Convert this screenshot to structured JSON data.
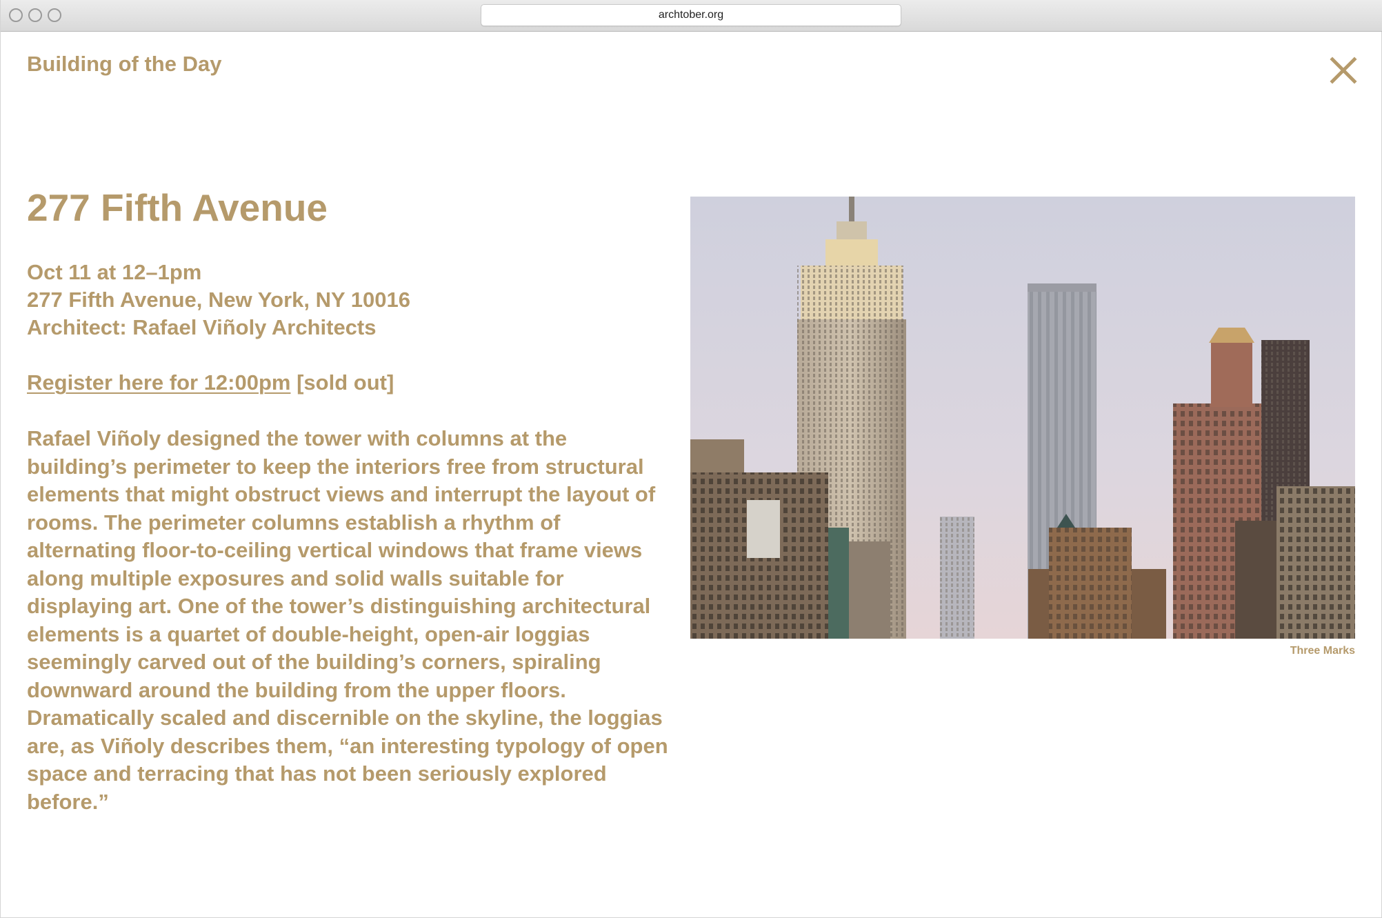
{
  "browser": {
    "url": "archtober.org"
  },
  "header": {
    "section_title": "Building of the Day",
    "close_icon": "close-icon"
  },
  "event": {
    "title": "277 Fifth Avenue",
    "date_time": "Oct 11 at 12–1pm",
    "address": "277 Fifth Avenue, New York, NY 10016",
    "architect": "Architect: Rafael Viñoly Architects",
    "register_link": "Register here for 12:00pm",
    "register_status": "[sold out]",
    "description": "Rafael Viñoly designed the tower with columns at the building’s perimeter to keep the interiors free from structural elements that might obstruct views and interrupt the layout of rooms. The perimeter columns establish a rhythm of alternating floor-to-ceiling vertical windows that frame views along multiple exposures and solid walls suitable for displaying art. One of the tower’s distinguishing architectural elements is a quartet of double-height, open-air loggias seemingly carved out of the building’s corners, spiraling downward around the building from the upper floors. Dramatically scaled and discernible on the skyline, the loggias are, as Viñoly describes them, “an interesting typology of open space and terracing that has not been seriously explored before.”"
  },
  "photo": {
    "credit": "Three Marks"
  },
  "colors": {
    "accent": "#b59a6b",
    "background": "#ffffff",
    "chrome": "#dcdcdc"
  }
}
